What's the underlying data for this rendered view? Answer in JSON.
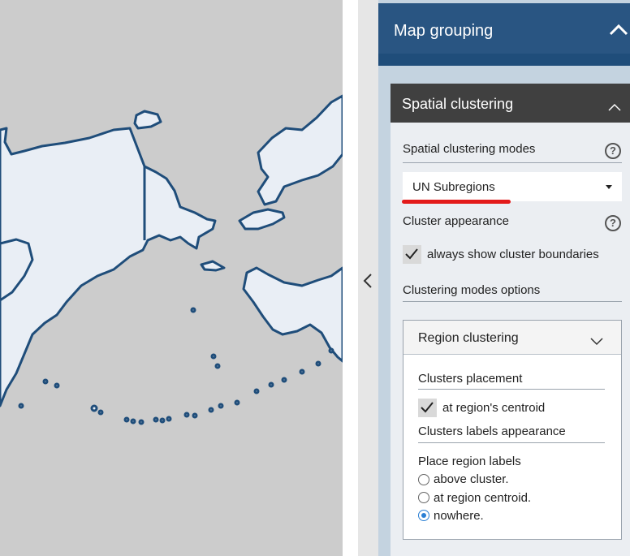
{
  "map": {
    "name": "Map"
  },
  "panel": {
    "title": "Map grouping",
    "section": {
      "title": "Spatial clustering",
      "modes_label": "Spatial clustering modes",
      "mode_value": "UN Subregions",
      "appearance_label": "Cluster appearance",
      "boundaries_label": "always show cluster boundaries",
      "boundaries_checked": true,
      "options_label": "Clustering modes options",
      "help_glyph": "?",
      "region": {
        "title": "Region clustering",
        "placement_label": "Clusters placement",
        "centroid_label": "at region's centroid",
        "centroid_checked": true,
        "labels_appearance": "Clusters labels appearance",
        "place_labels": "Place region labels",
        "options": [
          "above cluster.",
          "at region centroid.",
          "nowhere."
        ],
        "selected_option": "nowhere."
      }
    }
  },
  "colors": {
    "header": "#295582",
    "section_header": "#404040",
    "land": "#e9eef5",
    "coast": "#1f4d7a",
    "highlight": "#e31a1a"
  }
}
